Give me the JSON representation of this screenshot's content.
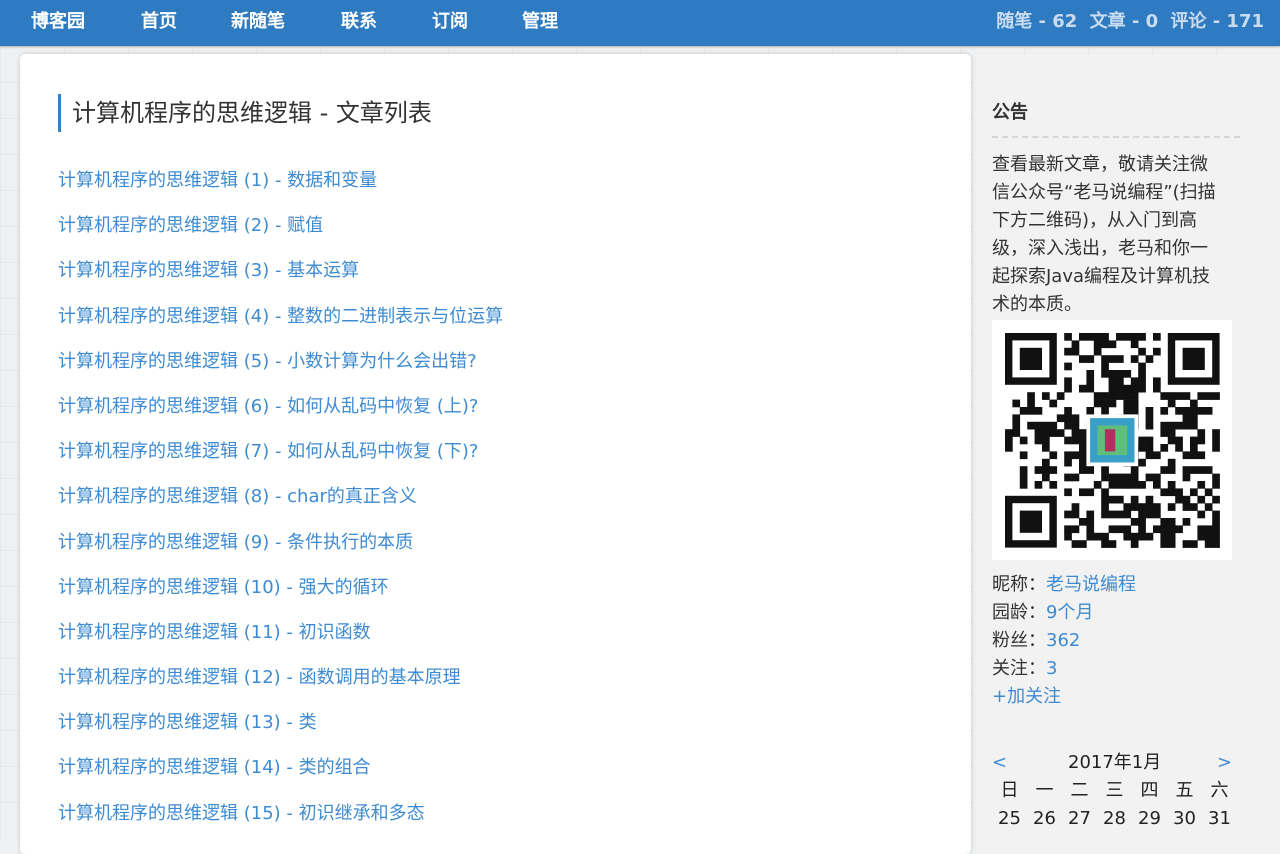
{
  "nav": {
    "brand": "博客园",
    "items": [
      "首页",
      "新随笔",
      "联系",
      "订阅",
      "管理"
    ],
    "stats": {
      "posts": "随笔 - 62",
      "articles": "文章 - 0",
      "comments": "评论 - 171"
    }
  },
  "main": {
    "title": "计算机程序的思维逻辑 - 文章列表",
    "posts": [
      "计算机程序的思维逻辑 (1) - 数据和变量",
      "计算机程序的思维逻辑 (2) - 赋值",
      "计算机程序的思维逻辑 (3) - 基本运算",
      "计算机程序的思维逻辑 (4) - 整数的二进制表示与位运算",
      "计算机程序的思维逻辑 (5) - 小数计算为什么会出错?",
      "计算机程序的思维逻辑 (6) - 如何从乱码中恢复 (上)?",
      "计算机程序的思维逻辑 (7) - 如何从乱码中恢复 (下)?",
      "计算机程序的思维逻辑 (8) - char的真正含义",
      "计算机程序的思维逻辑 (9) - 条件执行的本质",
      "计算机程序的思维逻辑 (10) - 强大的循环",
      "计算机程序的思维逻辑 (11) - 初识函数",
      "计算机程序的思维逻辑 (12) - 函数调用的基本原理",
      "计算机程序的思维逻辑 (13) - 类",
      "计算机程序的思维逻辑 (14) - 类的组合",
      "计算机程序的思维逻辑 (15) - 初识继承和多态"
    ]
  },
  "sidebar": {
    "notice_title": "公告",
    "notice_lines": [
      "查看最新文章，敬请关注微",
      "信公众号“老马说编程”(扫描",
      "下方二维码)，从入门到高",
      "级，深入浅出，老马和你一",
      "起探索Java编程及计算机技",
      "术的本质。"
    ],
    "profile": {
      "nickname_label": "昵称：",
      "nickname": "老马说编程",
      "age_label": "园龄：",
      "age": "9个月",
      "fans_label": "粉丝：",
      "fans": "362",
      "follow_label": "关注：",
      "follow": "3",
      "add_follow": "+加关注"
    },
    "calendar": {
      "prev": "<",
      "title": "2017年1月",
      "next": ">",
      "weekdays": [
        "日",
        "一",
        "二",
        "三",
        "四",
        "五",
        "六"
      ],
      "first_row": [
        "25",
        "26",
        "27",
        "28",
        "29",
        "30",
        "31"
      ]
    }
  },
  "colors": {
    "nav_bg": "#2f7bc1",
    "link": "#3e8bd2",
    "title_bar": "#3b7fc0"
  }
}
